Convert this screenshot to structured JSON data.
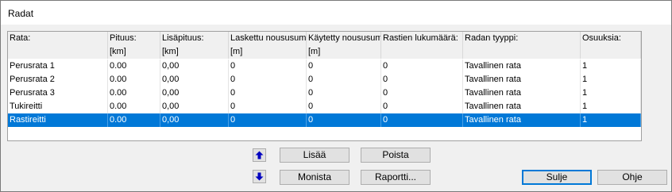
{
  "window": {
    "title": "Radat"
  },
  "table": {
    "headers": [
      "Rata:",
      "Pituus:",
      "Lisäpituus:",
      "Laskettu noususumma",
      "Käytetty noususumma",
      "Rastien lukumäärä:",
      "Radan tyyppi:",
      "Osuuksia:"
    ],
    "units": [
      "",
      "[km]",
      "[km]",
      "[m]",
      "[m]",
      "",
      "",
      ""
    ],
    "rows": [
      [
        "Perusrata 1",
        "0.00",
        "0,00",
        "0",
        "0",
        "0",
        "Tavallinen rata",
        "1"
      ],
      [
        "Perusrata 2",
        "0.00",
        "0,00",
        "0",
        "0",
        "0",
        "Tavallinen rata",
        "1"
      ],
      [
        "Perusrata 3",
        "0.00",
        "0,00",
        "0",
        "0",
        "0",
        "Tavallinen rata",
        "1"
      ],
      [
        "Tukireitti",
        "0.00",
        "0,00",
        "0",
        "0",
        "0",
        "Tavallinen rata",
        "1"
      ],
      [
        "Rastireitti",
        "0.00",
        "0,00",
        "0",
        "0",
        "0",
        "Tavallinen rata",
        "1"
      ]
    ],
    "selected_row": "Rastireitti"
  },
  "buttons": {
    "add": "Lisää",
    "remove": "Poista",
    "duplicate": "Monista",
    "report": "Raportti...",
    "close": "Sulje",
    "help": "Ohje"
  },
  "icons": {
    "move_up": "arrow-up-icon",
    "move_down": "arrow-down-icon"
  },
  "colors": {
    "selection": "#0078d7",
    "default_button_border": "#0078d7",
    "arrow": "#0000c0"
  }
}
